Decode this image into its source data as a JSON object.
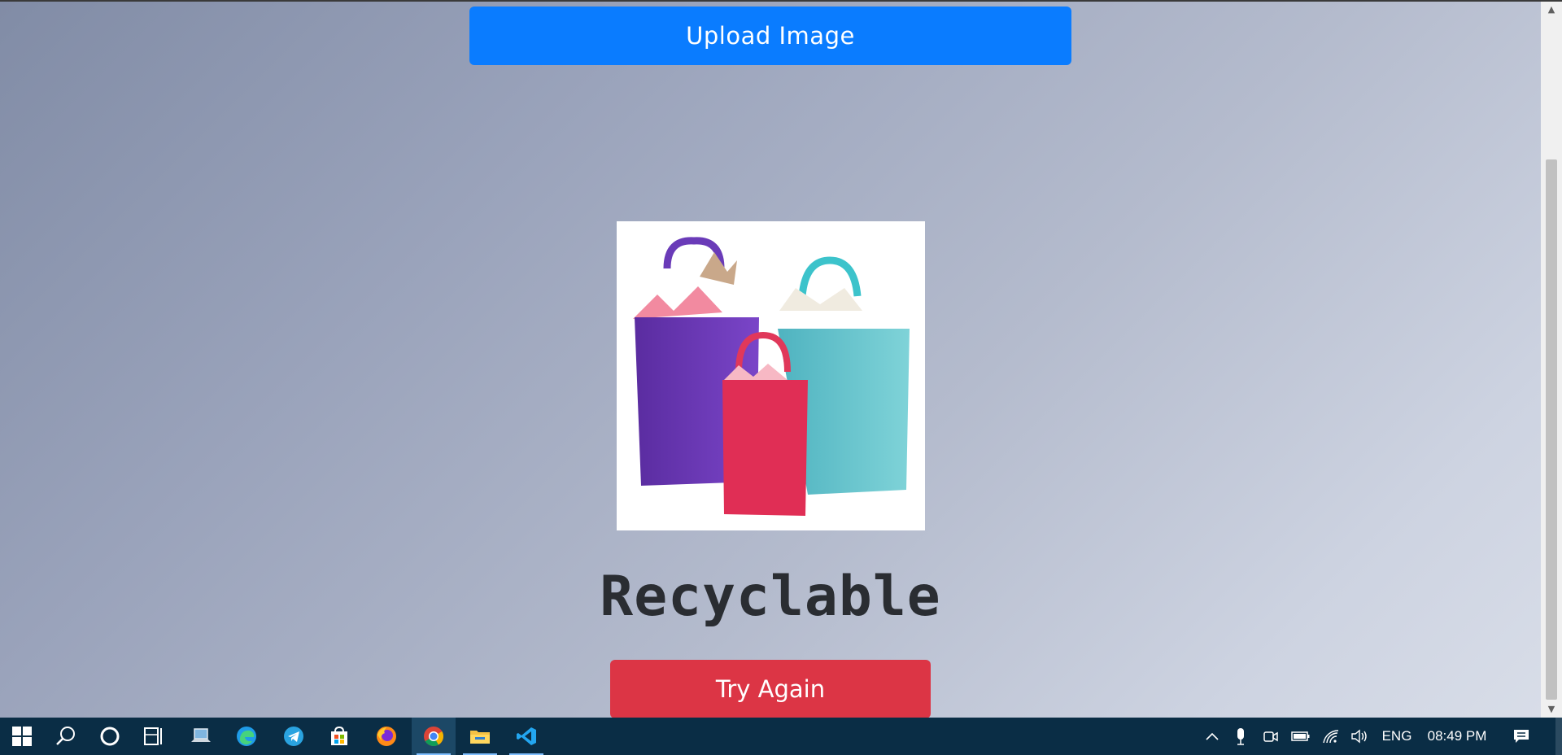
{
  "upload_button": {
    "label": "Upload Image"
  },
  "result": {
    "text": "Recyclable"
  },
  "try_again_button": {
    "label": "Try Again"
  },
  "taskbar": {
    "apps": [
      "start-icon",
      "search-icon",
      "cortana-icon",
      "task-view-icon",
      "laptop-icon",
      "edge-icon",
      "telegram-icon",
      "store-icon",
      "firefox-icon",
      "chrome-icon",
      "file-explorer-icon",
      "vscode-icon"
    ],
    "language": "ENG",
    "time": "08:49 PM"
  },
  "colors": {
    "upload_button": "#0a7cff",
    "try_again_button": "#dc3545",
    "taskbar": "#0a2d45"
  }
}
